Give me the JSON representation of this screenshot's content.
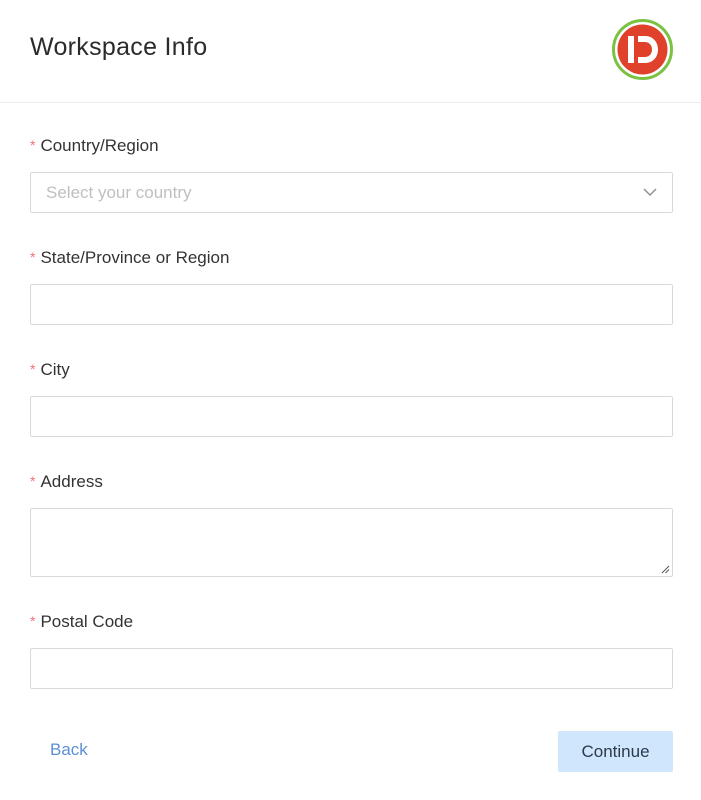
{
  "header": {
    "title": "Workspace Info",
    "logo_text": "ID",
    "logo_colors": {
      "ring": "#7cc242",
      "fill": "#e0412b",
      "glyph": "#ffffff"
    }
  },
  "form": {
    "required_mark": "*",
    "required_color": "#f0707a",
    "fields": {
      "country": {
        "label": "Country/Region",
        "placeholder": "Select your country",
        "value": ""
      },
      "state": {
        "label": "State/Province or Region",
        "value": ""
      },
      "city": {
        "label": "City",
        "value": ""
      },
      "address": {
        "label": "Address",
        "value": ""
      },
      "postal": {
        "label": "Postal Code",
        "value": ""
      }
    }
  },
  "footer": {
    "back_label": "Back",
    "continue_label": "Continue",
    "colors": {
      "back_text": "#5b8fd6",
      "continue_bg": "#cfe6fc"
    }
  },
  "icons": {
    "select_chevron": "chevron-down-icon",
    "resize": "resize-grip-icon"
  }
}
